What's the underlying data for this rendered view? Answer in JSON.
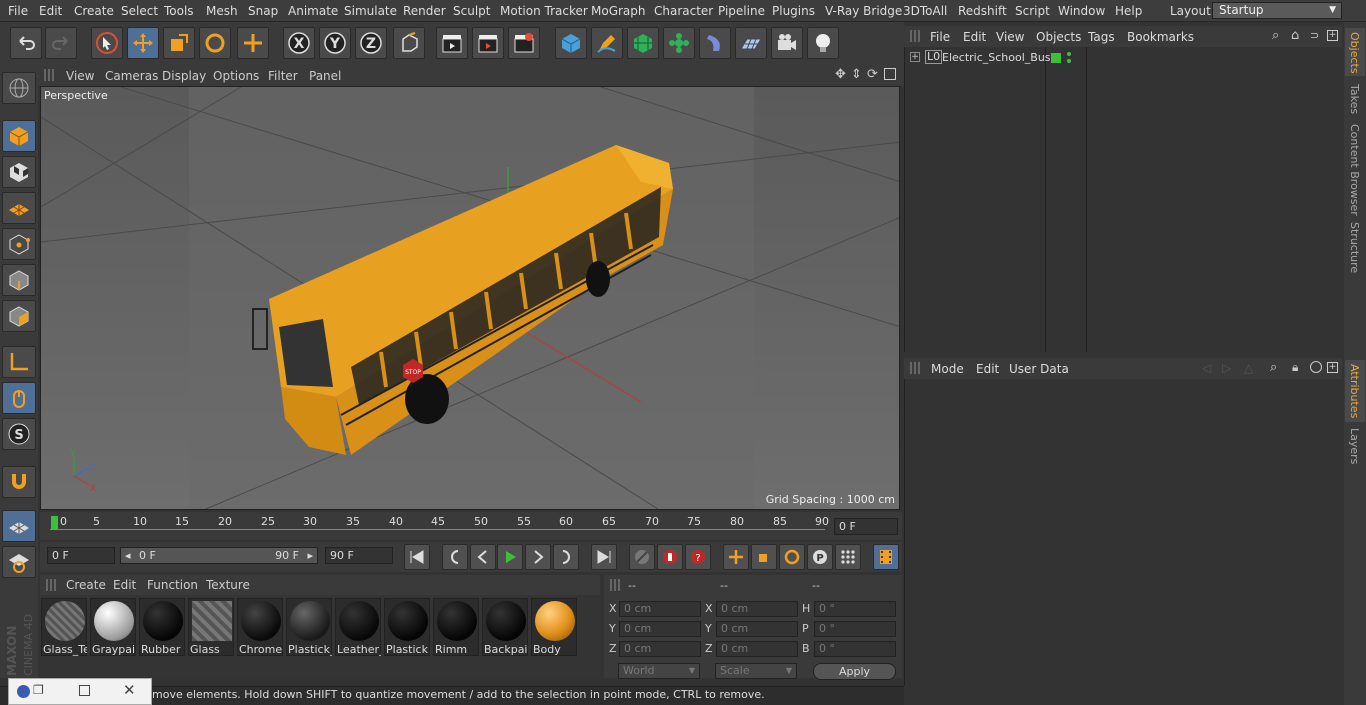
{
  "menubar": {
    "items": [
      "File",
      "Edit",
      "Create",
      "Select",
      "Tools",
      "Mesh",
      "Snap",
      "Animate",
      "Simulate",
      "Render",
      "Sculpt",
      "Motion Tracker",
      "MoGraph",
      "Character",
      "Pipeline",
      "Plugins",
      "V-Ray Bridge",
      "3DToAll",
      "Redshift",
      "Script",
      "Window",
      "Help"
    ],
    "layout_label": "Layout:",
    "layout_value": "Startup"
  },
  "viewport": {
    "menu": [
      "View",
      "Cameras",
      "Display",
      "Options",
      "Filter",
      "Panel"
    ],
    "label": "Perspective",
    "grid_spacing": "Grid Spacing : 1000 cm",
    "bus_stop_sign": "STOP"
  },
  "timeline": {
    "ticks": [
      "0",
      "5",
      "10",
      "15",
      "20",
      "25",
      "30",
      "35",
      "40",
      "45",
      "50",
      "55",
      "60",
      "65",
      "70",
      "75",
      "80",
      "85",
      "90"
    ],
    "current_frame": "0 F"
  },
  "playbar": {
    "start_field": "0 F",
    "range_start": "0 F",
    "range_end": "90 F",
    "end_field": "90 F"
  },
  "materials": {
    "menu": [
      "Create",
      "Edit",
      "Function",
      "Texture"
    ],
    "items": [
      {
        "label": "Glass_Te",
        "color": "#a04040"
      },
      {
        "label": "Graypai",
        "color": "#d9d9d9"
      },
      {
        "label": "Rubber",
        "color": "#111111"
      },
      {
        "label": "Glass",
        "color": "#555555"
      },
      {
        "label": "Chrome",
        "color": "#1a1a1a"
      },
      {
        "label": "Plastick_",
        "color": "#3a3a3a"
      },
      {
        "label": "Leather_",
        "color": "#151515"
      },
      {
        "label": "Plastick",
        "color": "#111111"
      },
      {
        "label": "Rimm",
        "color": "#111111"
      },
      {
        "label": "Backpai",
        "color": "#111111"
      },
      {
        "label": "Body",
        "color": "#e0901a"
      }
    ]
  },
  "coords": {
    "headers": [
      "--",
      "--",
      "--"
    ],
    "rows": [
      {
        "a": "X",
        "av": "0 cm",
        "b": "X",
        "bv": "0 cm",
        "c": "H",
        "cv": "0 °"
      },
      {
        "a": "Y",
        "av": "0 cm",
        "b": "Y",
        "bv": "0 cm",
        "c": "P",
        "cv": "0 °"
      },
      {
        "a": "Z",
        "av": "0 cm",
        "b": "Z",
        "bv": "0 cm",
        "c": "B",
        "cv": "0 °"
      }
    ],
    "mode": "World",
    "scale": "Scale",
    "apply": "Apply"
  },
  "status": {
    "text": "move elements. Hold down SHIFT to quantize movement / add to the selection in point mode, CTRL to remove."
  },
  "objects": {
    "menu": [
      "File",
      "Edit",
      "View",
      "Objects",
      "Tags",
      "Bookmarks"
    ],
    "items": [
      {
        "name": "Electric_School_Bus",
        "layer": "L0"
      }
    ]
  },
  "attributes": {
    "menu": [
      "Mode",
      "Edit",
      "User Data"
    ]
  },
  "right_tabs": [
    "Objects",
    "Takes",
    "Content Browser",
    "Structure",
    "Attributes",
    "Layers"
  ],
  "logo": {
    "brand": "MAXON",
    "product": "CINEMA 4D"
  }
}
